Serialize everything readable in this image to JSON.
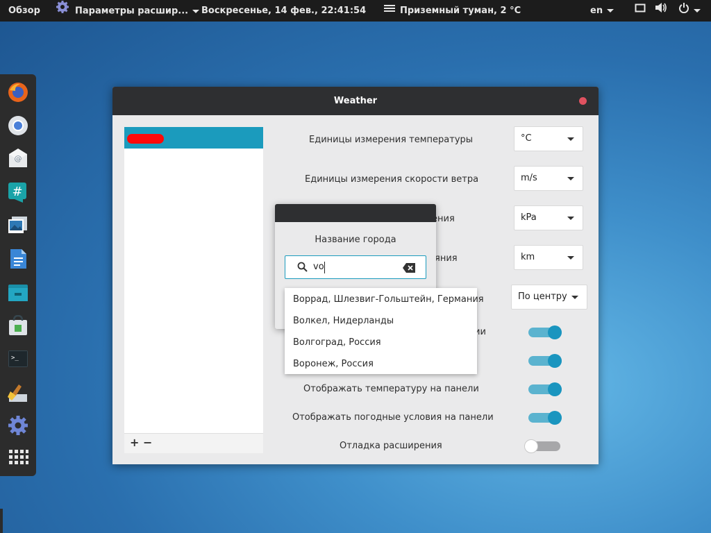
{
  "topbar": {
    "activities": "Обзор",
    "app_menu": "Параметры расшир...",
    "clock": "Воскресенье, 14 фев., 22:41:54",
    "weather": "Приземный туман, 2 °C",
    "language": "en"
  },
  "dock": {
    "apps": [
      "firefox-icon",
      "chromium-icon",
      "mail-icon",
      "chat-icon",
      "image-viewer-icon",
      "document-icon",
      "files-icon",
      "software-icon",
      "terminal-icon",
      "cleaner-icon",
      "settings-icon",
      "app-grid-icon"
    ]
  },
  "window": {
    "title": "Weather",
    "list": {
      "add": "+",
      "remove": "−"
    },
    "settings": {
      "temp_unit_label": "Единицы измерения температуры",
      "temp_unit_value": "°C",
      "wind_unit_label": "Единицы измерения скорости ветра",
      "wind_unit_value": "m/s",
      "pressure_label_partial": "ения",
      "pressure_unit_value": "kPa",
      "distance_label_partial": "яния",
      "distance_unit_value": "km",
      "position_value": "По центру",
      "switch1_label_partial": "ии",
      "temp_panel_label": "Отображать температуру на панели",
      "cond_panel_label": "Отображать погодные условия на панели",
      "debug_label": "Отладка расширения"
    },
    "switches": {
      "s1": true,
      "s2": true,
      "temp_panel": true,
      "cond_panel": true,
      "debug": false
    }
  },
  "popover": {
    "title": "Название города",
    "search_value": "vo",
    "suggestions": [
      "Воррад, Шлезвиг-Гольштейн, Германия",
      "Волкел, Нидерланды",
      "Волгоград, Россия",
      "Воронеж, Россия"
    ]
  },
  "colors": {
    "accent": "#1b9bbd",
    "close": "#e05260",
    "redacted": "#ff0a0a"
  }
}
